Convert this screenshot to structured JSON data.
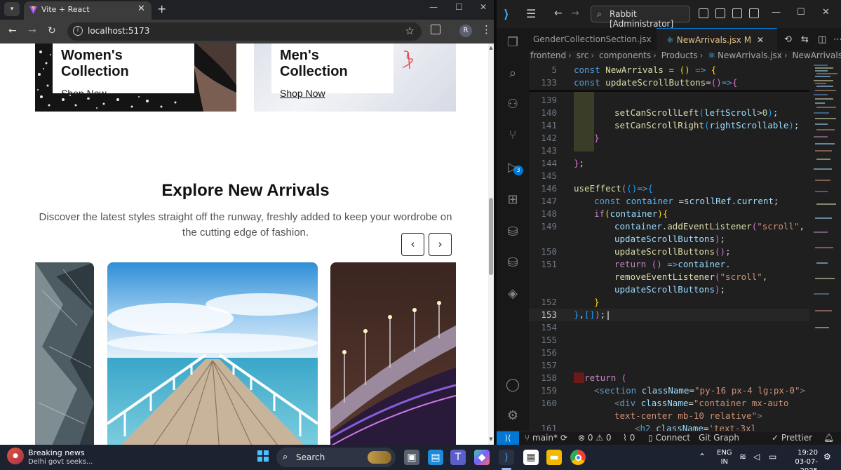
{
  "browser": {
    "tab_title": "Vite + React",
    "url": "localhost:5173",
    "profile_initial": "R"
  },
  "page": {
    "collections": [
      {
        "title": "Women's Collection",
        "link": "Shop Now"
      },
      {
        "title": "Men's Collection",
        "link": "Shop Now"
      }
    ],
    "section_title": "Explore New Arrivals",
    "section_desc_line1": "Discover the latest styles straight off the runway, freshly added to keep your wordrobe on",
    "section_desc_line2": "the cutting edge of fashion.",
    "prev_icon": "chevron-left-icon",
    "next_icon": "chevron-right-icon"
  },
  "vscode": {
    "command_center": "Rabbit [Administrator]",
    "tabs": [
      {
        "label": "GenderCollectionSection.jsx"
      },
      {
        "label": "NewArrivals.jsx",
        "modified": "M"
      }
    ],
    "breadcrumb": [
      "frontend",
      "src",
      "components",
      "Products",
      "NewArrivals.jsx",
      "NewArrivals"
    ],
    "scm_badge": "3",
    "lines": {
      "n5": "5",
      "n133": "133",
      "n139": "139",
      "n140": "140",
      "n141": "141",
      "n142": "142",
      "n143": "143",
      "n144": "144",
      "n145": "145",
      "n146": "146",
      "n147": "147",
      "n148": "148",
      "n149": "149",
      "n150": "150",
      "n151": "151",
      "n152": "152",
      "n153": "153",
      "n154": "154",
      "n155": "155",
      "n156": "156",
      "n157": "157",
      "n158": "158",
      "n159": "159",
      "n160": "160",
      "n161": "161"
    },
    "status": {
      "branch": "main*",
      "errors": "0",
      "warnings": "0",
      "ports": "0",
      "connect": "Connect",
      "git_graph": "Git Graph",
      "prettier": "Prettier"
    }
  },
  "taskbar": {
    "news_title": "Breaking news",
    "news_sub": "Delhi govt seeks...",
    "search": "Search",
    "lang_top": "ENG",
    "lang_bottom": "IN",
    "time": "19:20",
    "date": "03-07-2025"
  }
}
